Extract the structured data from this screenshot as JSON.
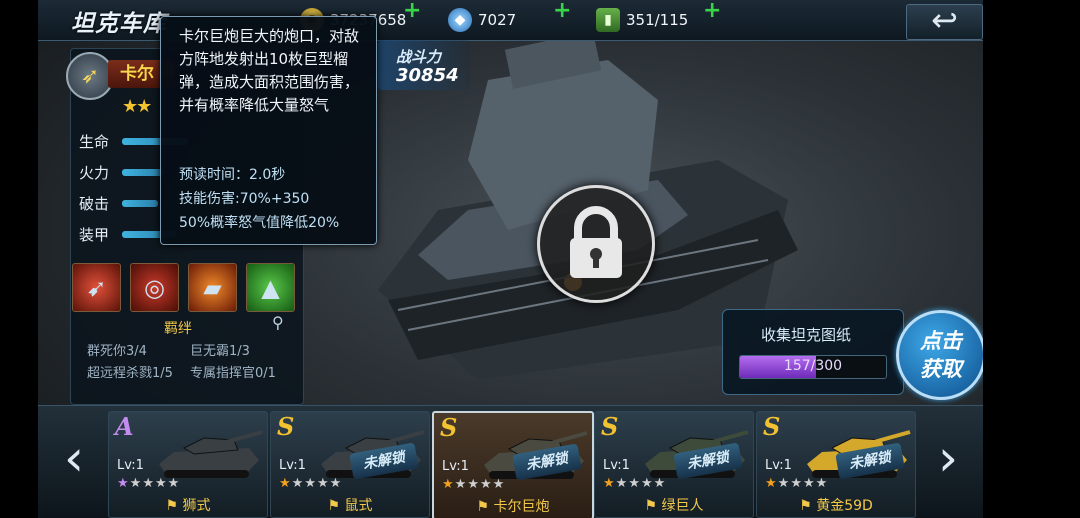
{
  "header": {
    "title": "坦克车库",
    "gold": "37237658",
    "diamonds": "7027",
    "fuel": "351/115",
    "back_icon": "back-arrow-icon"
  },
  "tank": {
    "name": "卡尔",
    "power_label": "战斗力",
    "power_value": "30854",
    "stats": [
      {
        "label": "生命",
        "fraction": 0.55
      },
      {
        "label": "火力",
        "fraction": 0.35
      },
      {
        "label": "破击",
        "fraction": 0.3
      },
      {
        "label": "装甲",
        "fraction": 0.45
      }
    ],
    "skills": [
      "missile-skill-icon",
      "mine-skill-icon",
      "bomb-skill-icon",
      "tank-buff-skill-icon"
    ],
    "bond_title": "羁绊",
    "bonds": [
      "群死你3/4",
      "巨无霸1/3",
      "超远程杀戮1/5",
      "专属指挥官0/1"
    ]
  },
  "tooltip": {
    "description": "卡尔巨炮巨大的炮口，对敌方阵地发射出10枚巨型榴弹，造成大面积范围伤害，并有概率降低大量怒气",
    "cast_time": "预读时间：2.0秒",
    "damage": "技能伤害:70%+350",
    "effect": "50%概率怒气值降低20%"
  },
  "collect": {
    "label": "收集坦克图纸",
    "progress_text": "157/300",
    "progress_fraction": 0.523,
    "button_label": "点击获取"
  },
  "garage": {
    "cards": [
      {
        "rank": "A",
        "rank_color": "#c58cf0",
        "level": "Lv:1",
        "stars": 1,
        "name": "狮式",
        "locked": false,
        "selected": false,
        "tank_color": "#3a3f44"
      },
      {
        "rank": "S",
        "rank_color": "#f2c230",
        "level": "Lv:1",
        "stars": 1,
        "name": "鼠式",
        "locked": true,
        "selected": false,
        "tank_color": "#3a3f44"
      },
      {
        "rank": "S",
        "rank_color": "#f2c230",
        "level": "Lv:1",
        "stars": 1,
        "name": "卡尔巨炮",
        "locked": true,
        "selected": true,
        "tank_color": "#4a4a40"
      },
      {
        "rank": "S",
        "rank_color": "#f2c230",
        "level": "Lv:1",
        "stars": 1,
        "name": "绿巨人",
        "locked": true,
        "selected": false,
        "tank_color": "#3e4a3a"
      },
      {
        "rank": "S",
        "rank_color": "#f2c230",
        "level": "Lv:1",
        "stars": 1,
        "name": "黄金59D",
        "locked": true,
        "selected": false,
        "tank_color": "#d4a82a"
      }
    ],
    "locked_label": "未解锁"
  }
}
